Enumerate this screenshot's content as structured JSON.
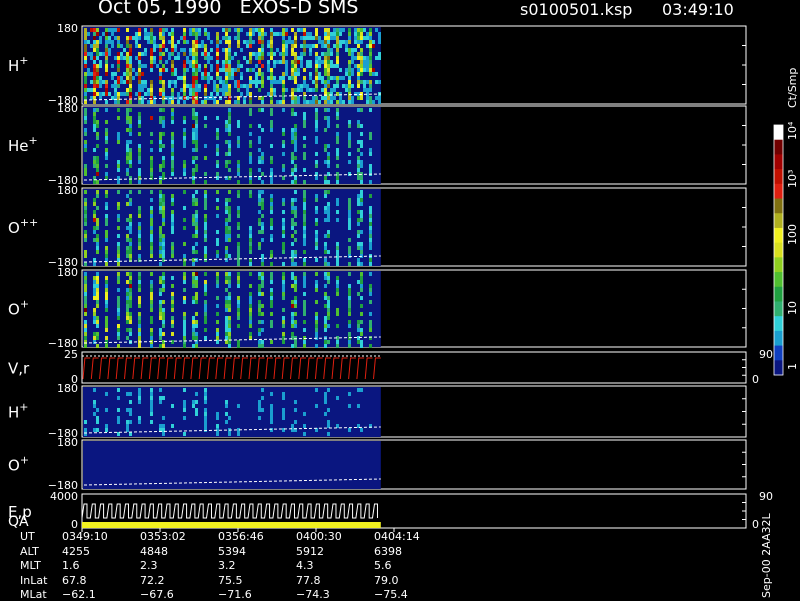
{
  "header": {
    "title": "Oct 05, 1990   EXOS-D SMS",
    "file": "s0100501.ksp",
    "time": "03:49:10"
  },
  "side_label": "Sep-00 2AA32L",
  "chart_data": {
    "type": "heatmap",
    "colorbar": {
      "label": "Ct/Smp",
      "ticks": [
        "1",
        "10",
        "100",
        "10³",
        "10⁴"
      ],
      "colors": [
        "#0a1680",
        "#1040c0",
        "#1a9fd0",
        "#30d0d8",
        "#30b070",
        "#20a040",
        "#50c030",
        "#90d020",
        "#d8e020",
        "#f0f020",
        "#b0b020",
        "#807010",
        "#e02010",
        "#c01000",
        "#a00000",
        "#700000",
        "#ffffff"
      ]
    },
    "panels": [
      {
        "label": "H",
        "sup": "+",
        "yticks": [
          "180",
          "−180"
        ],
        "intensity": 1.0
      },
      {
        "label": "He",
        "sup": "+",
        "yticks": [
          "180",
          "−180"
        ],
        "intensity": 0.45
      },
      {
        "label": "O",
        "sup": "++",
        "yticks": [
          "180",
          "−180"
        ],
        "intensity": 0.5
      },
      {
        "label": "O",
        "sup": "+",
        "yticks": [
          "180",
          "−180"
        ],
        "intensity": 0.6
      },
      {
        "label": "V,r",
        "sup": "",
        "yticks": [
          "25",
          "0"
        ],
        "right_ticks": [
          "90",
          "0"
        ],
        "kind": "line"
      },
      {
        "label": "H",
        "sup": "+",
        "yticks": [
          "180",
          "−180"
        ],
        "intensity": 0.25
      },
      {
        "label": "O",
        "sup": "+",
        "yticks": [
          "180",
          "−180"
        ],
        "intensity": 0.05
      },
      {
        "label": "E,p",
        "label2": "QA",
        "sup": "",
        "yticks": [
          "4000",
          "0"
        ],
        "right_ticks": [
          "90",
          "0"
        ],
        "kind": "step"
      }
    ],
    "data_end_fraction": 0.45,
    "x_ticks": [
      "0349:10",
      "0353:02",
      "0356:46",
      "0400:30",
      "0404:14"
    ],
    "ephemeris": [
      {
        "name": "UT",
        "values": [
          "0349:10",
          "0353:02",
          "0356:46",
          "0400:30",
          "0404:14"
        ]
      },
      {
        "name": "ALT",
        "values": [
          "4255",
          "4848",
          "5394",
          "5912",
          "6398"
        ]
      },
      {
        "name": "MLT",
        "values": [
          "1.6",
          "2.3",
          "3.2",
          "4.3",
          "5.6"
        ]
      },
      {
        "name": "InLat",
        "values": [
          "67.8",
          "72.2",
          "75.5",
          "77.8",
          "79.0"
        ]
      },
      {
        "name": "MLat",
        "values": [
          "−62.1",
          "−67.6",
          "−71.6",
          "−74.3",
          "−75.4"
        ]
      }
    ]
  }
}
